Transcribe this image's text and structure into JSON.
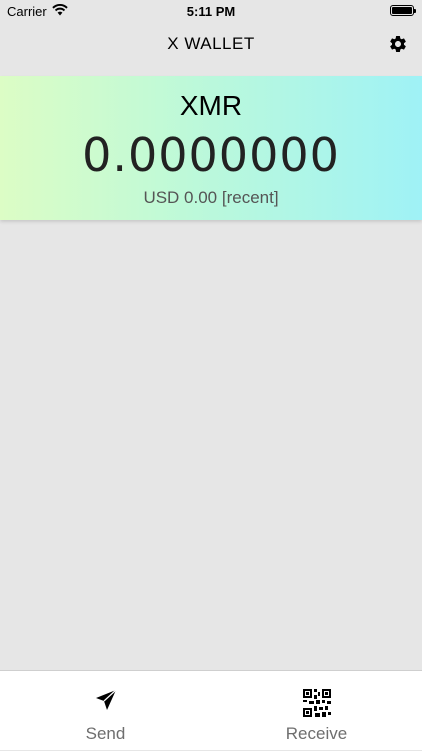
{
  "status_bar": {
    "carrier": "Carrier",
    "time": "5:11 PM"
  },
  "nav": {
    "title": "X WALLET",
    "settings_icon": "gear-icon"
  },
  "balance": {
    "currency": "XMR",
    "amount": "0.0000000",
    "fiat_text": "USD 0.00 [recent]"
  },
  "tabs": [
    {
      "label": "Send",
      "icon": "paper-plane-icon"
    },
    {
      "label": "Receive",
      "icon": "qr-code-icon"
    }
  ],
  "colors": {
    "gradient_start": "#dcfdc5",
    "gradient_end": "#9ff2f6",
    "background": "#e6e6e6"
  }
}
